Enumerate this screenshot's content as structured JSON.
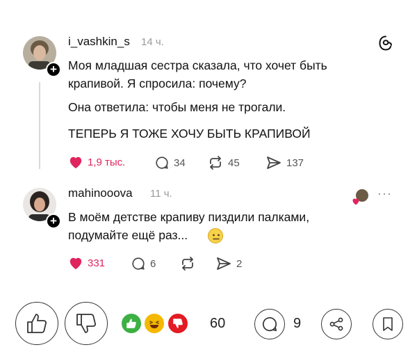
{
  "post1": {
    "username": "i_vashkin_s",
    "time": "14 ч.",
    "text_lines": [
      "Моя младшая сестра сказала, что хочет быть",
      "крапивой. Я спросила: почему?",
      "Она ответила: чтобы меня не трогали.",
      "ТЕПЕРЬ Я ТОЖЕ ХОЧУ БЫТЬ КРАПИВОЙ"
    ],
    "likes": "1,9 тыс.",
    "comments": "34",
    "reposts": "45",
    "shares": "137",
    "icons": [
      "threads-logo-icon",
      "heart-icon",
      "comment-icon",
      "repost-icon",
      "share-icon"
    ]
  },
  "post2": {
    "username": "mahinooova",
    "time": "11 ч.",
    "text_lines": [
      "В моём детстве крапиву пиздили палками,",
      "подумайте ещё раз..."
    ],
    "emoji": "🙂",
    "likes": "331",
    "comments": "6",
    "reposts": "",
    "shares": "2",
    "more": "···"
  },
  "bottom_bar": {
    "reactions_count": "60",
    "comments_count": "9",
    "icons": [
      "like-icon",
      "dislike-icon",
      "comment-icon",
      "share-icon",
      "bookmark-icon"
    ]
  },
  "colors": {
    "like_red": "#e0245e",
    "like_green": "#3cb043",
    "laugh_yellow": "#f5b800",
    "dislike_red": "#e31b23"
  }
}
